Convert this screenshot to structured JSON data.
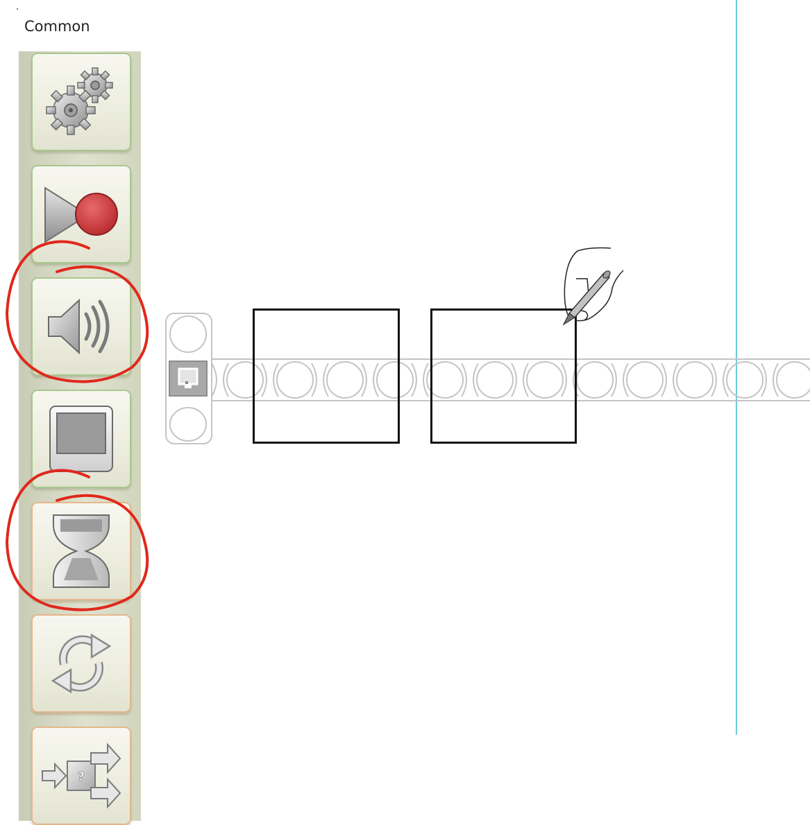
{
  "palette": {
    "title": "Common",
    "items": [
      {
        "name": "move",
        "icon": "gears-icon"
      },
      {
        "name": "record-play",
        "icon": "record-play-icon"
      },
      {
        "name": "sound",
        "icon": "speaker-icon"
      },
      {
        "name": "display",
        "icon": "display-icon"
      },
      {
        "name": "wait",
        "icon": "hourglass-icon"
      },
      {
        "name": "loop",
        "icon": "loop-arrows-icon"
      },
      {
        "name": "switch",
        "icon": "switch-icon"
      }
    ]
  },
  "annotations": {
    "circled_tools": [
      "sound",
      "wait"
    ],
    "ink_color": "#e0281c"
  },
  "program": {
    "start_block_icon": "start-block-icon",
    "empty_slots": 2
  },
  "colors": {
    "palette_bg": "#dfe2cf",
    "guide_line": "#6ccad8",
    "sequence_beam": "#c4c4c4",
    "slot_border": "#111111"
  }
}
